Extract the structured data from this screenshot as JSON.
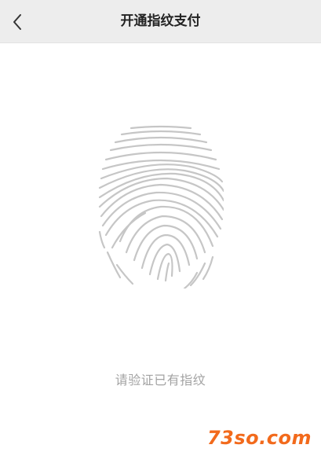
{
  "header": {
    "title": "开通指纹支付",
    "back_icon": "chevron-left-icon"
  },
  "main": {
    "fingerprint_icon": "fingerprint-icon",
    "prompt": "请验证已有指纹"
  },
  "watermark": "73so.com",
  "colors": {
    "header_bg": "#ededed",
    "fingerprint": "#c4c4c4",
    "prompt": "#a3a3a3",
    "watermark": "#f26a1c"
  }
}
